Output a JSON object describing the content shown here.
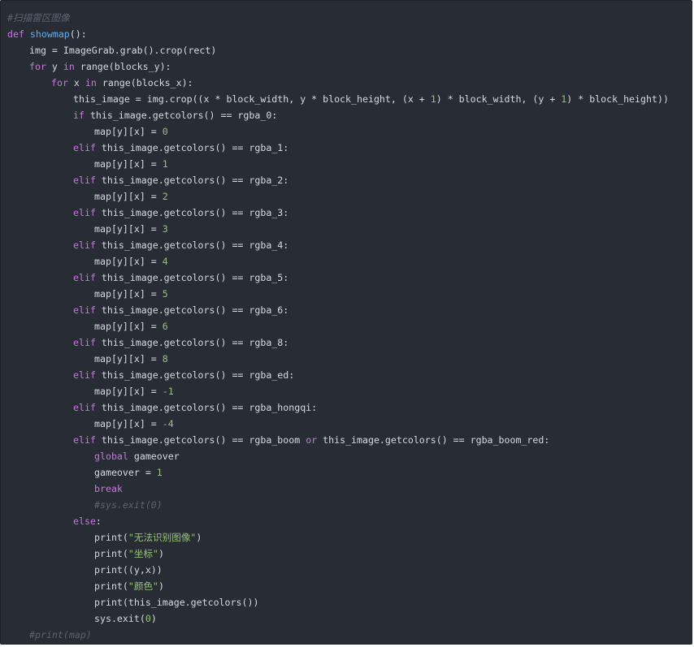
{
  "code": {
    "lines": [
      {
        "indent": 0,
        "tokens": [
          {
            "t": "cm",
            "v": "#扫描雷区图像"
          }
        ]
      },
      {
        "indent": 0,
        "tokens": [
          {
            "t": "kw",
            "v": "def "
          },
          {
            "t": "fn",
            "v": "showmap"
          },
          {
            "t": "tx",
            "v": "():"
          }
        ]
      },
      {
        "indent": 1,
        "tokens": [
          {
            "t": "tx",
            "v": "img = ImageGrab.grab().crop(rect)"
          }
        ]
      },
      {
        "indent": 1,
        "tokens": [
          {
            "t": "kw",
            "v": "for"
          },
          {
            "t": "tx",
            "v": " y "
          },
          {
            "t": "kw",
            "v": "in"
          },
          {
            "t": "tx",
            "v": " range(blocks_y):"
          }
        ]
      },
      {
        "indent": 2,
        "tokens": [
          {
            "t": "kw",
            "v": "for"
          },
          {
            "t": "tx",
            "v": " x "
          },
          {
            "t": "kw",
            "v": "in"
          },
          {
            "t": "tx",
            "v": " range(blocks_x):"
          }
        ]
      },
      {
        "indent": 3,
        "tokens": [
          {
            "t": "tx",
            "v": "this_image = img.crop((x * block_width, y * block_height, (x + "
          },
          {
            "t": "num",
            "v": "1"
          },
          {
            "t": "tx",
            "v": ") * block_width, (y + "
          },
          {
            "t": "num",
            "v": "1"
          },
          {
            "t": "tx",
            "v": ") * block_height))"
          }
        ]
      },
      {
        "indent": 3,
        "tokens": [
          {
            "t": "kw",
            "v": "if"
          },
          {
            "t": "tx",
            "v": " this_image.getcolors() == rgba_0:"
          }
        ]
      },
      {
        "indent": 4,
        "tokens": [
          {
            "t": "tx",
            "v": "map[y][x] = "
          },
          {
            "t": "num",
            "v": "0"
          }
        ]
      },
      {
        "indent": 3,
        "tokens": [
          {
            "t": "kw",
            "v": "elif"
          },
          {
            "t": "tx",
            "v": " this_image.getcolors() == rgba_1:"
          }
        ]
      },
      {
        "indent": 4,
        "tokens": [
          {
            "t": "tx",
            "v": "map[y][x] = "
          },
          {
            "t": "num",
            "v": "1"
          }
        ]
      },
      {
        "indent": 3,
        "tokens": [
          {
            "t": "kw",
            "v": "elif"
          },
          {
            "t": "tx",
            "v": " this_image.getcolors() == rgba_2:"
          }
        ]
      },
      {
        "indent": 4,
        "tokens": [
          {
            "t": "tx",
            "v": "map[y][x] = "
          },
          {
            "t": "num",
            "v": "2"
          }
        ]
      },
      {
        "indent": 3,
        "tokens": [
          {
            "t": "kw",
            "v": "elif"
          },
          {
            "t": "tx",
            "v": " this_image.getcolors() == rgba_3:"
          }
        ]
      },
      {
        "indent": 4,
        "tokens": [
          {
            "t": "tx",
            "v": "map[y][x] = "
          },
          {
            "t": "num",
            "v": "3"
          }
        ]
      },
      {
        "indent": 3,
        "tokens": [
          {
            "t": "kw",
            "v": "elif"
          },
          {
            "t": "tx",
            "v": " this_image.getcolors() == rgba_4:"
          }
        ]
      },
      {
        "indent": 4,
        "tokens": [
          {
            "t": "tx",
            "v": "map[y][x] = "
          },
          {
            "t": "num",
            "v": "4"
          }
        ]
      },
      {
        "indent": 3,
        "tokens": [
          {
            "t": "kw",
            "v": "elif"
          },
          {
            "t": "tx",
            "v": " this_image.getcolors() == rgba_5:"
          }
        ]
      },
      {
        "indent": 4,
        "tokens": [
          {
            "t": "tx",
            "v": "map[y][x] = "
          },
          {
            "t": "num",
            "v": "5"
          }
        ]
      },
      {
        "indent": 3,
        "tokens": [
          {
            "t": "kw",
            "v": "elif"
          },
          {
            "t": "tx",
            "v": " this_image.getcolors() == rgba_6:"
          }
        ]
      },
      {
        "indent": 4,
        "tokens": [
          {
            "t": "tx",
            "v": "map[y][x] = "
          },
          {
            "t": "num",
            "v": "6"
          }
        ]
      },
      {
        "indent": 3,
        "tokens": [
          {
            "t": "kw",
            "v": "elif"
          },
          {
            "t": "tx",
            "v": " this_image.getcolors() == rgba_8:"
          }
        ]
      },
      {
        "indent": 4,
        "tokens": [
          {
            "t": "tx",
            "v": "map[y][x] = "
          },
          {
            "t": "num",
            "v": "8"
          }
        ]
      },
      {
        "indent": 3,
        "tokens": [
          {
            "t": "kw",
            "v": "elif"
          },
          {
            "t": "tx",
            "v": " this_image.getcolors() == rgba_ed:"
          }
        ]
      },
      {
        "indent": 4,
        "tokens": [
          {
            "t": "tx",
            "v": "map[y][x] = "
          },
          {
            "t": "num",
            "v": "-1"
          }
        ]
      },
      {
        "indent": 3,
        "tokens": [
          {
            "t": "kw",
            "v": "elif"
          },
          {
            "t": "tx",
            "v": " this_image.getcolors() == rgba_hongqi:"
          }
        ]
      },
      {
        "indent": 4,
        "tokens": [
          {
            "t": "tx",
            "v": "map[y][x] = "
          },
          {
            "t": "num",
            "v": "-4"
          }
        ]
      },
      {
        "indent": 3,
        "tokens": [
          {
            "t": "kw",
            "v": "elif"
          },
          {
            "t": "tx",
            "v": " this_image.getcolors() == rgba_boom "
          },
          {
            "t": "kw",
            "v": "or"
          },
          {
            "t": "tx",
            "v": " this_image.getcolors() == rgba_boom_red:"
          }
        ]
      },
      {
        "indent": 4,
        "tokens": [
          {
            "t": "kw",
            "v": "global"
          },
          {
            "t": "tx",
            "v": " gameover"
          }
        ]
      },
      {
        "indent": 4,
        "tokens": [
          {
            "t": "tx",
            "v": "gameover = "
          },
          {
            "t": "num",
            "v": "1"
          }
        ]
      },
      {
        "indent": 4,
        "tokens": [
          {
            "t": "kw",
            "v": "break"
          }
        ]
      },
      {
        "indent": 4,
        "tokens": [
          {
            "t": "cm",
            "v": "#sys.exit(0)"
          }
        ]
      },
      {
        "indent": 3,
        "tokens": [
          {
            "t": "kw",
            "v": "else"
          },
          {
            "t": "tx",
            "v": ":"
          }
        ]
      },
      {
        "indent": 4,
        "tokens": [
          {
            "t": "tx",
            "v": "print("
          },
          {
            "t": "str",
            "v": "\"无法识别图像\""
          },
          {
            "t": "tx",
            "v": ")"
          }
        ]
      },
      {
        "indent": 4,
        "tokens": [
          {
            "t": "tx",
            "v": "print("
          },
          {
            "t": "str",
            "v": "\"坐标\""
          },
          {
            "t": "tx",
            "v": ")"
          }
        ]
      },
      {
        "indent": 4,
        "tokens": [
          {
            "t": "tx",
            "v": "print((y,x))"
          }
        ]
      },
      {
        "indent": 4,
        "tokens": [
          {
            "t": "tx",
            "v": "print("
          },
          {
            "t": "str",
            "v": "\"颜色\""
          },
          {
            "t": "tx",
            "v": ")"
          }
        ]
      },
      {
        "indent": 4,
        "tokens": [
          {
            "t": "tx",
            "v": "print(this_image.getcolors())"
          }
        ]
      },
      {
        "indent": 4,
        "tokens": [
          {
            "t": "tx",
            "v": "sys.exit("
          },
          {
            "t": "num",
            "v": "0"
          },
          {
            "t": "tx",
            "v": ")"
          }
        ]
      },
      {
        "indent": 1,
        "tokens": [
          {
            "t": "cm",
            "v": "#print(map)"
          }
        ]
      }
    ]
  }
}
